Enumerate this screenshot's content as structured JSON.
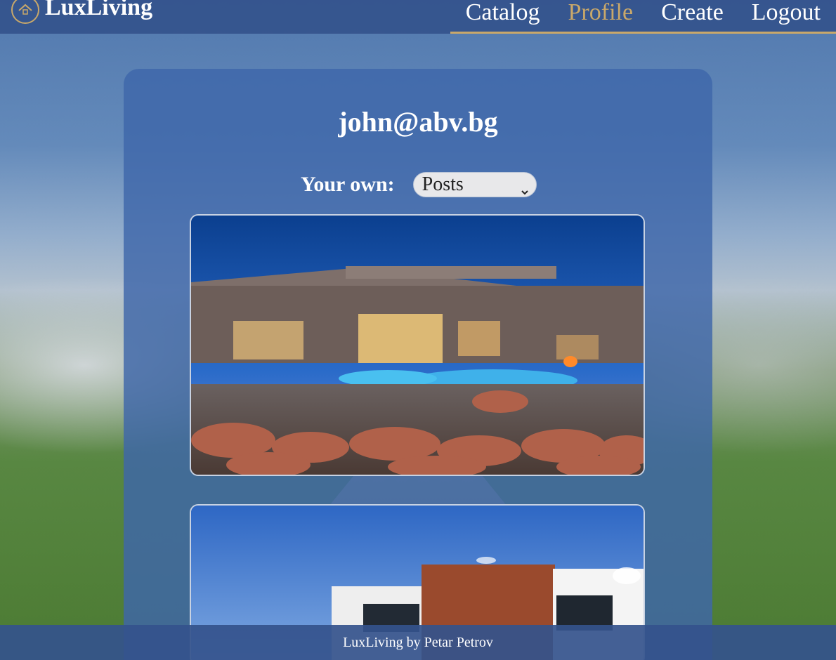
{
  "brand": {
    "name": "LuxLiving"
  },
  "nav": {
    "items": [
      {
        "label": "Catalog",
        "active": false
      },
      {
        "label": "Profile",
        "active": true
      },
      {
        "label": "Create",
        "active": false
      },
      {
        "label": "Logout",
        "active": false
      }
    ]
  },
  "profile": {
    "email": "john@abv.bg",
    "filter_label": "Your own:",
    "filter_selected": "Posts"
  },
  "footer": {
    "text": "LuxLiving by Petar Petrov"
  },
  "colors": {
    "accent": "#c9a86a",
    "header_bg": "#34528c",
    "card_bg": "#3e66aa"
  },
  "icons": {
    "logo": "house-icon",
    "select": "chevron-down-icon"
  }
}
